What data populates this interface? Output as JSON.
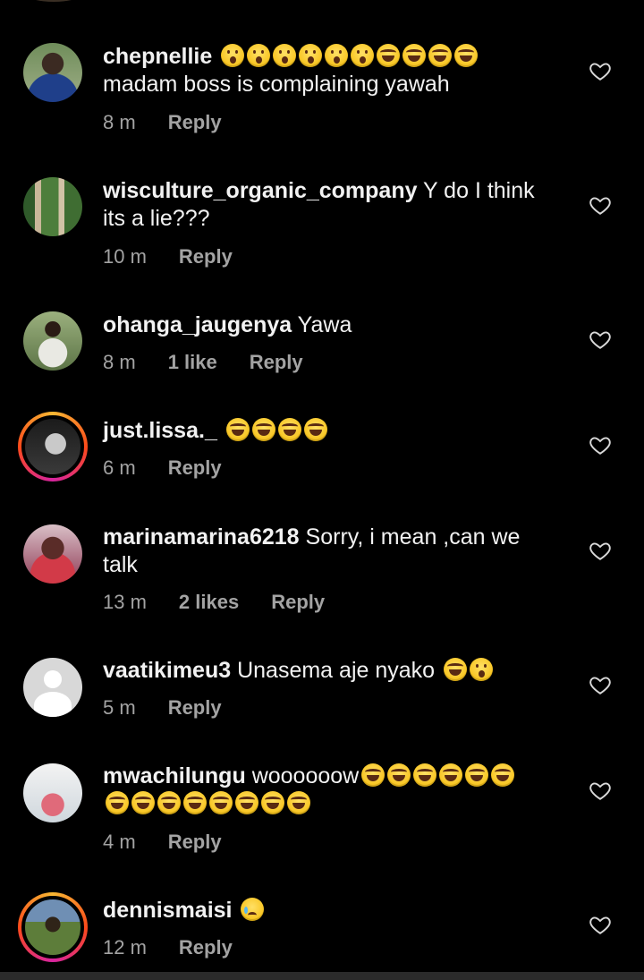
{
  "comments": [
    {
      "username": "chepnellie",
      "text": "",
      "text_line2": "madam boss is complaining yawah",
      "emojis": [
        "wow",
        "wow",
        "wow",
        "wow",
        "wow",
        "wow",
        "laugh",
        "laugh",
        "laugh",
        "laugh"
      ],
      "time": "8 m",
      "likes": "",
      "reply": "Reply"
    },
    {
      "username": "wisculture_organic_company",
      "text": "Y do I think",
      "text_line2": "its a lie???",
      "time": "10 m",
      "likes": "",
      "reply": "Reply"
    },
    {
      "username": "ohanga_jaugenya",
      "text": "Yawa",
      "time": "8 m",
      "likes": "1 like",
      "reply": "Reply"
    },
    {
      "username": "just.lissa._",
      "text": "",
      "emojis": [
        "laugh",
        "laugh",
        "laugh",
        "laugh"
      ],
      "time": "6 m",
      "likes": "",
      "reply": "Reply"
    },
    {
      "username": "marinamarina6218",
      "text": "Sorry, i mean ,can we",
      "text_line2": "talk",
      "time": "13 m",
      "likes": "2 likes",
      "reply": "Reply"
    },
    {
      "username": "vaatikimeu3",
      "text": "Unasema aje nyako",
      "emojis": [
        "laugh",
        "wow"
      ],
      "time": "5 m",
      "likes": "",
      "reply": "Reply"
    },
    {
      "username": "mwachilungu",
      "text": "woooooow",
      "emojis": [
        "laugh",
        "laugh",
        "laugh",
        "laugh",
        "laugh",
        "laugh"
      ],
      "emojis_line2": [
        "laugh",
        "laugh",
        "laugh",
        "laugh",
        "laugh",
        "laugh",
        "laugh",
        "laugh"
      ],
      "time": "4 m",
      "likes": "",
      "reply": "Reply"
    },
    {
      "username": "dennismaisi",
      "text": "",
      "emojis": [
        "cry"
      ],
      "time": "12 m",
      "likes": "",
      "reply": "Reply"
    }
  ],
  "icons": {
    "like": "heart-outline-icon"
  },
  "colors": {
    "background": "#000000",
    "text": "#f2f2f2",
    "meta": "#a3a3a3",
    "story_ring": "#fc4a1a"
  }
}
